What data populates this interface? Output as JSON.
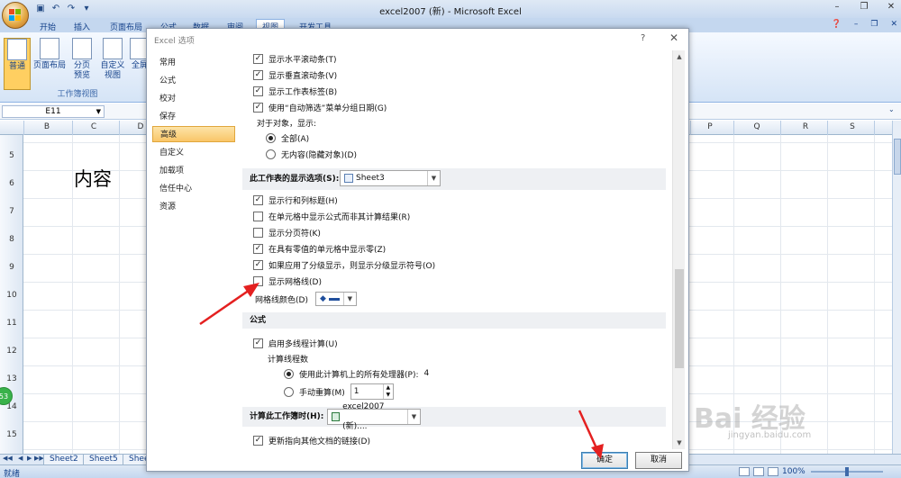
{
  "app": {
    "title": "excel2007 (新) - Microsoft Excel",
    "qat": [
      "save-icon",
      "undo-icon",
      "redo-icon",
      "customize-icon"
    ],
    "ribbon_tabs": [
      "开始",
      "插入",
      "页面布局",
      "公式",
      "数据",
      "审阅",
      "视图",
      "开发工具"
    ],
    "active_tab": "视图",
    "ribbon_group": {
      "label": "工作簿视图",
      "buttons": [
        "普通",
        "页面布局",
        "分页\n预览",
        "自定义\n视图",
        "全屏"
      ]
    },
    "name_box": "E11",
    "columns": [
      "B",
      "C",
      "D",
      "P",
      "Q",
      "R",
      "S"
    ],
    "rows": [
      "5",
      "6",
      "7",
      "8",
      "9",
      "10",
      "11",
      "12",
      "13",
      "14",
      "15"
    ],
    "cell_text": "内容",
    "sheet_tabs": [
      "Sheet2",
      "Sheet5",
      "Sheet"
    ],
    "status": "就绪",
    "zoom": "100%",
    "badge": "53",
    "watermark": "Bai 经验",
    "watermark_sub": "jingyan.baidu.com",
    "colors": {
      "ribbon": "#c4d7ef",
      "active_nav": "#f9c568"
    }
  },
  "dialog": {
    "title": "Excel 选项",
    "help": "?",
    "close": "✕",
    "nav": [
      "常用",
      "公式",
      "校对",
      "保存",
      "高级",
      "自定义",
      "加载项",
      "信任中心",
      "资源"
    ],
    "active_nav": "高级",
    "options_top": [
      {
        "label": "显示水平滚动条(T)",
        "checked": true
      },
      {
        "label": "显示垂直滚动条(V)",
        "checked": true
      },
      {
        "label": "显示工作表标签(B)",
        "checked": true
      },
      {
        "label": "使用“自动筛选”菜单分组日期(G)",
        "checked": true
      }
    ],
    "objects_label": "对于对象，显示:",
    "objects_options": [
      {
        "label": "全部(A)",
        "selected": true
      },
      {
        "label": "无内容(隐藏对象)(D)",
        "selected": false
      }
    ],
    "sheet_section": {
      "title": "此工作表的显示选项(S):",
      "combo_value": "Sheet3",
      "options": [
        {
          "label": "显示行和列标题(H)",
          "checked": true
        },
        {
          "label": "在单元格中显示公式而非其计算结果(R)",
          "checked": false
        },
        {
          "label": "显示分页符(K)",
          "checked": false
        },
        {
          "label": "在具有零值的单元格中显示零(Z)",
          "checked": true
        },
        {
          "label": "如果应用了分级显示，则显示分级显示符号(O)",
          "checked": true
        },
        {
          "label": "显示网格线(D)",
          "checked": false
        }
      ],
      "gridline_color_label": "网格线颜色(D)"
    },
    "formula_section": {
      "title": "公式",
      "multithread": {
        "label": "启用多线程计算(U)",
        "checked": true
      },
      "threads_label": "计算线程数",
      "use_all": {
        "label": "使用此计算机上的所有处理器(P):",
        "value": "4",
        "selected": true
      },
      "manual": {
        "label": "手动重算(M)",
        "value": "1",
        "selected": false
      }
    },
    "calc_section": {
      "title": "计算此工作簿时(H):",
      "combo_value": "excel2007 (新)....",
      "update_links": {
        "label": "更新指向其他文档的链接(D)",
        "checked": true
      }
    },
    "ok": "确定",
    "cancel": "取消"
  }
}
